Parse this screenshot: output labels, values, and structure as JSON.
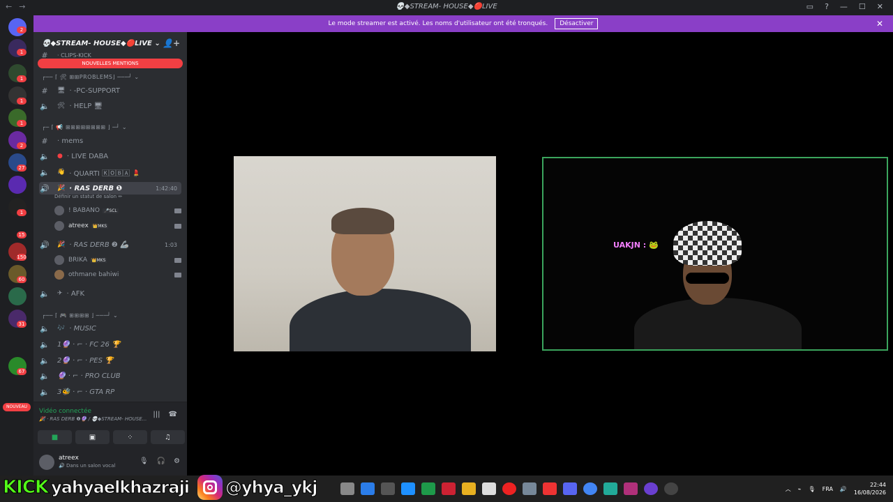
{
  "window": {
    "title": "💀◆STREAM- HOUSE◆🔴LIVE",
    "nav_back": "←",
    "nav_forward": "→",
    "controls": [
      "▭",
      "?",
      "—",
      "☐",
      "✕"
    ]
  },
  "banner": {
    "text": "Le mode streamer est activé. Les noms d'utilisateur ont été tronqués.",
    "button_label": "Désactiver",
    "close": "✕"
  },
  "servers": {
    "badges": [
      "2",
      "1",
      "1",
      "1",
      "1",
      "1",
      "2",
      "27",
      "1",
      "15",
      "150",
      "60",
      "31",
      "67"
    ],
    "nouveau_label": "NOUVEAU"
  },
  "guild": {
    "name": "💀◆STREAM- HOUSE◆🔴LIVE ⌄",
    "add_icon": "👤+",
    "mentions_label": "NOUVELLES MENTIONS",
    "clips_channel": "· CLIPS-KICK"
  },
  "channels": {
    "cat_problems": "┌── ⌈ 🛠 ⊞⊞PROBLEMS⌋ ───┘ ⌄",
    "pc_support": "· -PC-SUPPORT",
    "help": "· HELP 🖥",
    "cat_media": "┌─ ⌈ 📢 ⊞⊞⊞⊞⊞⊞⊞⊞ ⌋ ─┘ ⌄",
    "mems": "· mems",
    "live_daba": "· LIVE DABA",
    "quarti": "· QUARTI 🄺🄾🄱🄰 💄",
    "ras_derb_1": "· RAS DERB ❶",
    "ras_derb_1_time": "1:42:40",
    "ras_derb_1_status": "Définir un statut de salon ✏",
    "ras_derb_2": "· RAS DERB ❷ 🦾",
    "ras_derb_2_time": "1:03",
    "afk": "· AFK",
    "cat_games": "┌── ⌈ 🎮 ⊞⊞⊞⊞ ⌋ ───┘ ⌄",
    "music": "· MUSIC",
    "fc26": "1🔮 · ⌐ · FC 26 🏆",
    "pes": "2🔮 · ⌐ · PES 🏆",
    "proclub": "🔮 · ⌐ · PRO CLUB",
    "gtarp": "3🐝 · ⌐ · GTA RP"
  },
  "voice_users": [
    {
      "name": "! BABANO",
      "tag": "🎤SCL"
    },
    {
      "name": "atreex",
      "tag": "👑MKS"
    },
    {
      "name": "BRIKA",
      "tag": "👑MKS"
    },
    {
      "name": "othmane bahiwi",
      "tag": ""
    }
  ],
  "voice_panel": {
    "title": "Vidéo connectée",
    "subtitle": "🎉 · RAS DERB ❶🔮 / 💀◆STREAM- HOUSE..."
  },
  "user_panel": {
    "name": "atreex",
    "status": "🔊 Dans un salon vocal"
  },
  "video": {
    "overlay_label": "UAKJN : 🐸"
  },
  "social": {
    "kick": "KICK",
    "kick_user": "yahyaelkhazraji",
    "ig_user": "@yhya_ykj"
  },
  "tray": {
    "lang": "FRA",
    "time": "22:44",
    "date": "16/08/2026"
  },
  "colors": {
    "accent": "#8a3fc7",
    "mention": "#f23f43",
    "speaking": "#3ba55d",
    "kick_green": "#53fc18"
  }
}
